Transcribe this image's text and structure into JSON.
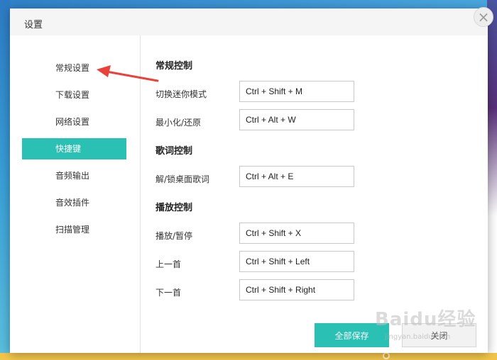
{
  "dialog": {
    "title": "设置",
    "close_icon": "close-icon"
  },
  "sidebar": {
    "items": [
      {
        "label": "常规设置",
        "active": false
      },
      {
        "label": "下载设置",
        "active": false
      },
      {
        "label": "网络设置",
        "active": false
      },
      {
        "label": "快捷键",
        "active": true
      },
      {
        "label": "音频输出",
        "active": false
      },
      {
        "label": "音效插件",
        "active": false
      },
      {
        "label": "扫描管理",
        "active": false
      }
    ]
  },
  "sections": {
    "general": {
      "title": "常规控制",
      "rows": [
        {
          "label": "切换迷你模式",
          "value": "Ctrl + Shift + M"
        },
        {
          "label": "最小化/还原",
          "value": "Ctrl + Alt + W"
        }
      ]
    },
    "lyrics": {
      "title": "歌词控制",
      "rows": [
        {
          "label": "解/锁桌面歌词",
          "value": "Ctrl + Alt + E"
        }
      ]
    },
    "playback": {
      "title": "播放控制",
      "rows": [
        {
          "label": "播放/暂停",
          "value": "Ctrl + Shift + X"
        },
        {
          "label": "上一首",
          "value": "Ctrl + Shift + Left"
        },
        {
          "label": "下一首",
          "value": "Ctrl + Shift + Right"
        }
      ]
    }
  },
  "buttons": {
    "save_all": "全部保存",
    "close": "关闭"
  },
  "watermark": {
    "text": "Baidu经验",
    "sub": "jingyan.baidu.com"
  },
  "colors": {
    "accent": "#2bc0b4",
    "annotation_arrow": "#e8423a"
  }
}
